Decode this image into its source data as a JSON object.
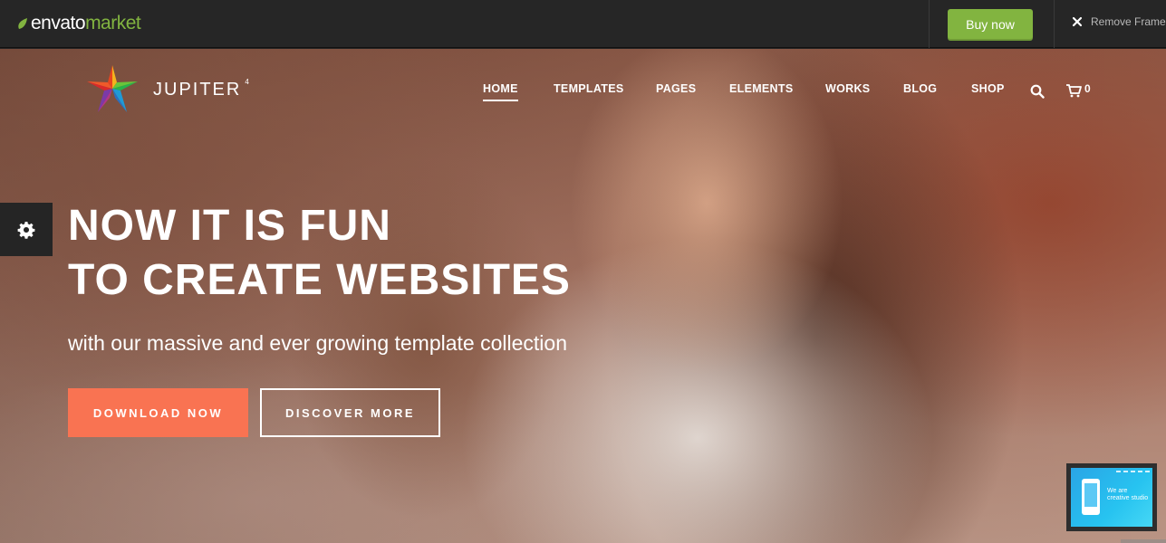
{
  "topbar": {
    "brand_prefix": "envato",
    "brand_suffix": "market",
    "buy_label": "Buy now",
    "remove_frame_label": "Remove Frame"
  },
  "site": {
    "logo_text": "JUPITER",
    "logo_version": "4"
  },
  "nav": {
    "items": [
      {
        "label": "HOME",
        "active": true
      },
      {
        "label": "TEMPLATES"
      },
      {
        "label": "PAGES"
      },
      {
        "label": "ELEMENTS"
      },
      {
        "label": "WORKS"
      },
      {
        "label": "BLOG"
      },
      {
        "label": "SHOP"
      }
    ],
    "search_icon": "search-icon",
    "cart_icon": "cart-icon",
    "cart_count": "0"
  },
  "hero": {
    "headline_line1": "NOW IT IS FUN",
    "headline_line2": "TO CREATE WEBSITES",
    "subline": "with our massive and ever growing template collection",
    "primary_button": "DOWNLOAD NOW",
    "secondary_button": "DISCOVER MORE"
  },
  "preview": {
    "text_line1": "We are",
    "text_line2": "creative studio"
  },
  "colors": {
    "envato_green": "#82b440",
    "cta_orange": "#f97352",
    "topbar_bg": "#262626"
  }
}
